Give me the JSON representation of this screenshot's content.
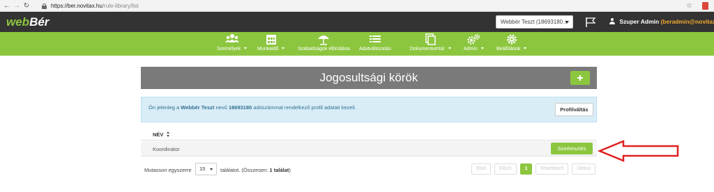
{
  "browser": {
    "url_host": "https://ber.novitax.hu",
    "url_path": "/rule-library/list",
    "back_glyph": "←",
    "forward_glyph": "→",
    "reload_glyph": "↻",
    "star_glyph": "☆"
  },
  "header": {
    "logo_web": "web",
    "logo_ber": "Bér",
    "company_select": "Webbér Teszt (18693180...",
    "user_name": "Szuper Admin",
    "user_email": "(beradmin@novitax.hu)"
  },
  "menu": {
    "items": [
      {
        "label": "Személyek",
        "icon": "people-icon",
        "dropdown": true
      },
      {
        "label": "Munkaidő",
        "icon": "calendar-icon",
        "dropdown": true
      },
      {
        "label": "Szabadságok elbírálása",
        "icon": "umbrella-icon",
        "dropdown": false
      },
      {
        "label": "Adatváltozatás",
        "icon": "list-icon",
        "dropdown": false
      },
      {
        "label": "Dokumentumtár",
        "icon": "documents-icon",
        "dropdown": true
      },
      {
        "label": "Admin",
        "icon": "gears-icon",
        "dropdown": true
      },
      {
        "label": "Beállítások",
        "icon": "gear-icon",
        "dropdown": true
      }
    ]
  },
  "page": {
    "title": "Jogosultsági körök"
  },
  "info": {
    "prefix": "Ön jelenleg a ",
    "company": "Webbér Teszt",
    "middle": " nevű ",
    "tax_id": "18693180",
    "suffix": " adószámmal rendelkező profil adatait kezeli.",
    "profile_switch": "Profilváltás"
  },
  "table": {
    "column_name": "NÉV",
    "rows": [
      {
        "name": "Koordinátor",
        "action": "Szerkesztés"
      }
    ]
  },
  "footer": {
    "per_page_label": "Mutasson egyszerre",
    "per_page_value": "15",
    "results_prefix": "találatot. (Összesen: ",
    "results_count": "1 találat",
    "results_suffix": ")",
    "pager": {
      "first": "Első",
      "prev": "Előző",
      "current": "1",
      "next": "Következő",
      "last": "Utolsó"
    }
  },
  "colors": {
    "brand_green": "#8cc63f",
    "dark_header": "#333333",
    "title_gray": "#7a7a7a",
    "info_bg": "#d9edf7",
    "annotation_red": "#e02020"
  }
}
